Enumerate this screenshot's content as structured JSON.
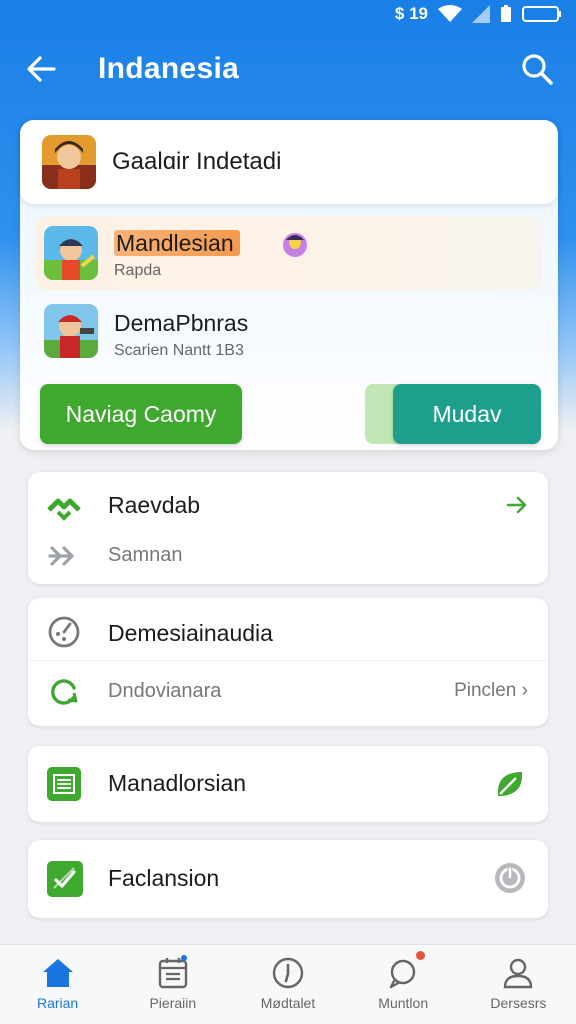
{
  "status_bar": {
    "time": "$ 19"
  },
  "app_bar": {
    "title": "Indanesia"
  },
  "game_card": {
    "header_title": "Gaalɑir Indetadi",
    "items": [
      {
        "title": "Mandlesian",
        "subtitle": "Rapda"
      },
      {
        "title": "DemaPbnras",
        "subtitle": "Scarien Nantt 1B3"
      }
    ],
    "primary_button": "Naviag Caomy",
    "secondary_button": "Mudav"
  },
  "cards": {
    "card1": {
      "title": "Raevdab",
      "subtitle": "Samnan"
    },
    "card2": {
      "title": "Demesiainaudia",
      "subtitle": "Dndovianara",
      "action": "Pinclen"
    },
    "card3": {
      "title": "Manadlorsian"
    },
    "card4": {
      "title": "Faclansion"
    }
  },
  "bottom_nav": [
    {
      "label": "Rarian",
      "icon": "home-icon",
      "active": true
    },
    {
      "label": "Pieraiin",
      "icon": "calendar-icon",
      "active": false
    },
    {
      "label": "Mødtalet",
      "icon": "compass-icon",
      "active": false
    },
    {
      "label": "Muntlon",
      "icon": "chat-icon",
      "active": false
    },
    {
      "label": "Dersesrs",
      "icon": "profile-icon",
      "active": false
    }
  ],
  "colors": {
    "primary_blue": "#1a7fe6",
    "green": "#3fa82f",
    "teal": "#1e9e8c",
    "active_nav": "#1976e0"
  }
}
